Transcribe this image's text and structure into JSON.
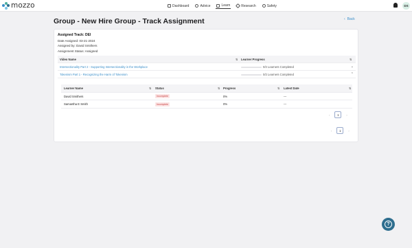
{
  "app": {
    "logo_text": "mozzo"
  },
  "nav": {
    "items": [
      {
        "label": "Dashboard",
        "icon": "dashboard-icon"
      },
      {
        "label": "Advice",
        "icon": "advice-icon"
      },
      {
        "label": "Learn",
        "icon": "learn-icon",
        "active": true
      },
      {
        "label": "Research",
        "icon": "research-icon"
      },
      {
        "label": "Safety",
        "icon": "safety-icon"
      }
    ],
    "avatar_initials": "DS"
  },
  "page": {
    "title": "Group - New Hire Group - Track Assignment",
    "back_label": "Back"
  },
  "assignment": {
    "track": "Assigned Track: DEI",
    "date": "Date Assigned: 03-21-2024",
    "assigned_by": "Assigned by: David Smithers",
    "status": "Assignment Status: Assigned"
  },
  "videos_table": {
    "headers": {
      "name": "Video Name",
      "progress": "Learner Progress"
    },
    "rows": [
      {
        "name": "Intersectionality Part 2 - Supporting Intersectionality in the Workplace",
        "progress": "0/2 Learners Completed",
        "progress_fraction": 0,
        "expanded": false
      },
      {
        "name": "Tokenism Part 1 - Recognizing the Harm of Tokenism",
        "progress": "0/2 Learners Completed",
        "progress_fraction": 0,
        "expanded": true
      }
    ]
  },
  "learners_table": {
    "headers": {
      "name": "Learner Name",
      "status": "Status",
      "progress": "Progress",
      "date": "Latest Date"
    },
    "rows": [
      {
        "name": "David Smithers",
        "status": "Incomplete",
        "progress": "0%",
        "date": "---"
      },
      {
        "name": "Samantha E Smith",
        "status": "Incomplete",
        "progress": "0%",
        "date": "---"
      }
    ]
  },
  "pagination": {
    "inner_page": "1",
    "outer_page": "1"
  },
  "colors": {
    "accent": "#3a8ec9",
    "help_button": "#2f6e8e",
    "badge_bg": "#fbe3e3",
    "badge_text": "#c94545"
  }
}
